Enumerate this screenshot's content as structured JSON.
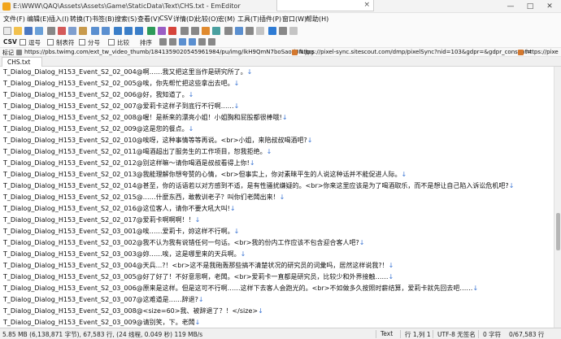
{
  "window": {
    "title": "E:\\WWW\\QAQ\\Assets\\Assets\\Game\\StaticData\\Text\\CHS.txt - EmEditor",
    "tab_close": "×",
    "minimize": "—",
    "maximize": "□",
    "close": "✕"
  },
  "menu": [
    "文件(F)",
    "编辑(E)",
    "插入(I)",
    "转换(T)",
    "书签(B)",
    "搜索(S)",
    "查看(V)",
    "CSV",
    "详情(D)",
    "比较(O)",
    "宏(M)",
    "工具(T)",
    "插件(P)",
    "窗口(W)",
    "帮助(H)"
  ],
  "toolbar2": {
    "csv": "CSV",
    "items": [
      "逗号",
      "制表符",
      "分号",
      "比较",
      "排序"
    ]
  },
  "bookmarks": {
    "label": "标记",
    "items": [
      "https://pbs.twimg.com/ext_tw_video_thumb/1841359020545961984/pu/img/lkH9QmN7boSaod0N.jpg",
      "https://pixel-sync.sitescout.com/dmp/pixelSync?nid=103&gdpr=&gdpr_consent=",
      "https://pixe"
    ]
  },
  "doc_tab": "CHS.txt",
  "lines": [
    "T_Dialog_Dialog_H153_Event_S2_02_004@啊……我又把这里当作是研究所了。",
    "T_Dialog_Dialog_H153_Event_S2_02_005@唉，你先帮忙把这些拿出去吧。",
    "T_Dialog_Dialog_H153_Event_S2_02_006@好，我知道了。",
    "T_Dialog_Dialog_H153_Event_S2_02_007@爱莉卡这样子到底行不行啊……",
    "T_Dialog_Dialog_H153_Event_S2_02_008@喔！是新来的漂亮小姐！小姐胸和屁股都很棒哦!",
    "T_Dialog_Dialog_H153_Event_S2_02_009@这是您的餐点。",
    "T_Dialog_Dialog_H153_Event_S2_02_010@唉呀，这种事情等等再说。<br>小姐，来陪叔叔喝酒吧?",
    "T_Dialog_Dialog_H153_Event_S2_02_011@喝酒超出了服务生的工作项目，恕我拒绝。",
    "T_Dialog_Dialog_H153_Event_S2_02_012@别这样嘛～请你喝酒是叔叔看得上你!",
    "T_Dialog_Dialog_H153_Event_S2_02_013@我能理解你想夸赞的心情，<br>但事实上，你对素昧平生的人说这种话并不能促进人际。",
    "T_Dialog_Dialog_H153_Event_S2_02_014@甚至，你的话语若以对方感到不适，是有性骚扰嫌疑的。<br>你来这里应该是为了喝酒取乐，而不是想让自己陷入诉讼危机吧?",
    "T_Dialog_Dialog_H153_Event_S2_02_015@……什麼东西，敢教训老子？叫你们老闆出来！",
    "T_Dialog_Dialog_H153_Event_S2_02_016@这位客人，请你不要大吼大叫!",
    "T_Dialog_Dialog_H153_Event_S2_02_017@爱莉卡啊啊啊！！",
    "T_Dialog_Dialog_H153_Event_S2_03_001@唉……爱莉卡，妳这样不行啊。",
    "T_Dialog_Dialog_H153_Event_S2_03_002@我不认为我有说错任何一句话。<br>我的份内工作应该不包含迎合客人吧?",
    "T_Dialog_Dialog_H153_Event_S2_03_003@妳……唉，这是哪里来的天兵啊。",
    "T_Dialog_Dialog_H153_Event_S2_03_004@天兵...?！<br>这不是我砲轰那些搞不清楚状况的研究员的词彙吗，居然这样说我?！",
    "T_Dialog_Dialog_H153_Event_S2_03_005@好了好了！不好意思啊，老闆。<br>爱莉卡一直都是研究员，比较少和外界接触……",
    "T_Dialog_Dialog_H153_Event_S2_03_006@原来是这样。但是这可不行啊……这样下去客人会跑光的。<br>不如做多久按照时薪结算，爱莉卡就先回去吧……",
    "T_Dialog_Dialog_H153_Event_S2_03_007@这难道是……辞退?",
    "T_Dialog_Dialog_H153_Event_S2_03_008@<size=60>我、被辞退了？！</size>",
    "T_Dialog_Dialog_H153_Event_S2_03_009@请别笑，下。老闆"
  ],
  "newline_glyph": "↓",
  "status": {
    "size": "5.85 MB (6,138,871 字节), 67,583 行, (24 线程, 0.049 秒) 119 MB/s",
    "encoding_type": "Text",
    "position": "行 1,列 1",
    "encoding": "UTF-8 无签名",
    "chars": "0 字符",
    "lines": "0/67,583 行"
  },
  "colors": {
    "newline": "#3d76d4",
    "app_accent": "#f2a51a"
  }
}
